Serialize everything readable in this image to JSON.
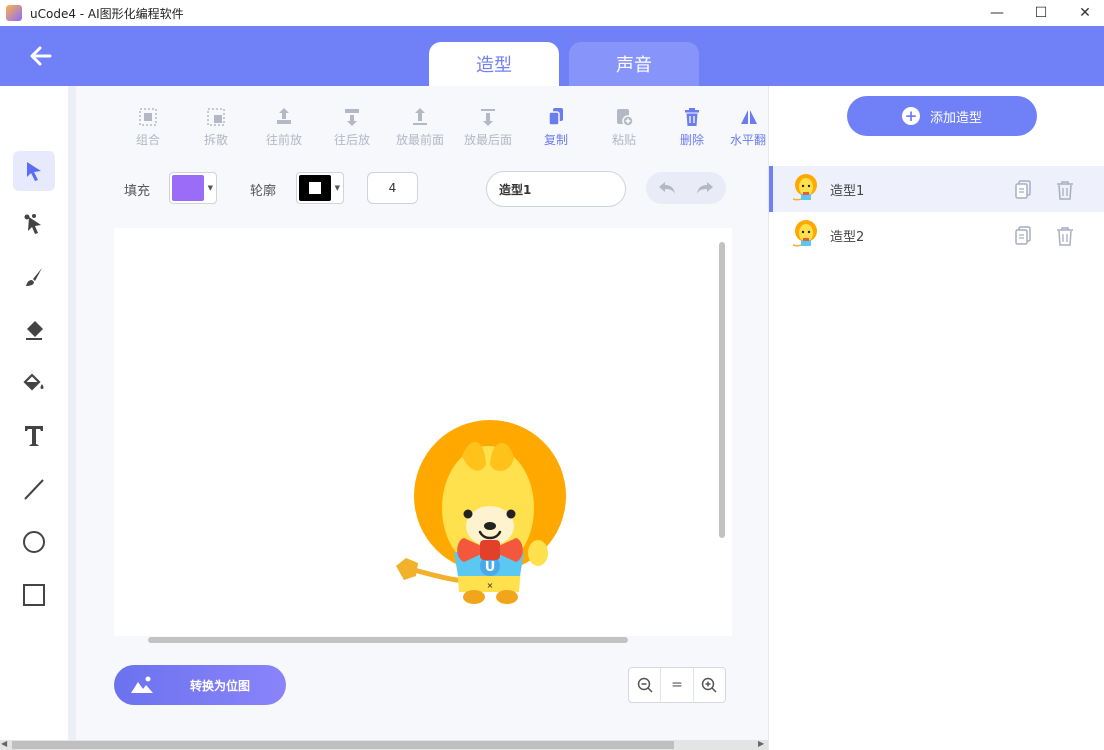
{
  "window": {
    "title": "uCode4 - AI图形化编程软件",
    "minimize": "—",
    "maximize": "☐",
    "close": "✕"
  },
  "header": {
    "tabs": [
      {
        "label": "造型"
      },
      {
        "label": "声音"
      }
    ]
  },
  "tools": [
    "select-arrow-icon",
    "reshape-icon",
    "brush-icon",
    "eraser-icon",
    "fill-bucket-icon",
    "text-tool-icon",
    "line-tool-icon",
    "circle-tool-icon",
    "rectangle-tool-icon"
  ],
  "toolbar": {
    "items": [
      {
        "label": "组合",
        "icon": "group-icon",
        "enabled": false
      },
      {
        "label": "拆散",
        "icon": "ungroup-icon",
        "enabled": false
      },
      {
        "label": "往前放",
        "icon": "forward-icon",
        "enabled": false
      },
      {
        "label": "往后放",
        "icon": "backward-icon",
        "enabled": false
      },
      {
        "label": "放最前面",
        "icon": "front-icon",
        "enabled": false
      },
      {
        "label": "放最后面",
        "icon": "back-icon",
        "enabled": false
      },
      {
        "label": "复制",
        "icon": "copy-icon",
        "enabled": true
      },
      {
        "label": "粘贴",
        "icon": "paste-icon",
        "enabled": false
      },
      {
        "label": "删除",
        "icon": "delete-icon",
        "enabled": true
      },
      {
        "label": "水平翻",
        "icon": "flip-horizontal-icon",
        "enabled": true
      }
    ]
  },
  "fill": {
    "label": "填充",
    "color": "#9b6cf7"
  },
  "outline": {
    "label": "轮廓",
    "color": "#000000",
    "width": "4"
  },
  "costume_name": "造型1",
  "bitmap_button": {
    "label": "转换为位图"
  },
  "zoom": {
    "out": "−",
    "reset": "=",
    "in": "+"
  },
  "colors": {
    "accent": "#7080f6",
    "disabled": "#b4b8c5"
  },
  "right_panel": {
    "add_button": "添加造型",
    "costumes": [
      {
        "name": "造型1",
        "selected": true
      },
      {
        "name": "造型2",
        "selected": false
      }
    ]
  }
}
